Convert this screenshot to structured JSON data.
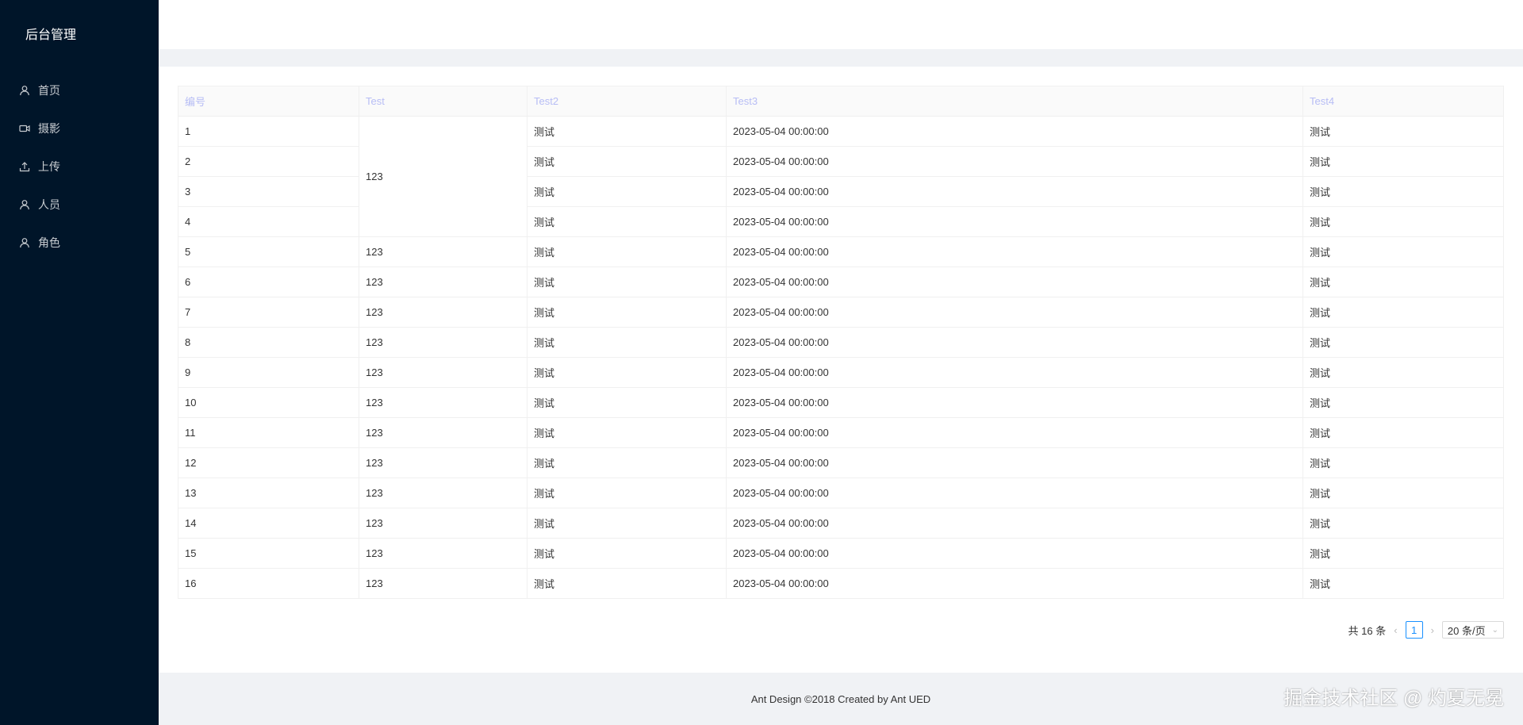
{
  "sidebar": {
    "title": "后台管理",
    "items": [
      {
        "label": "首页",
        "icon": "user-icon"
      },
      {
        "label": "摄影",
        "icon": "video-camera-icon"
      },
      {
        "label": "上传",
        "icon": "upload-icon"
      },
      {
        "label": "人员",
        "icon": "user-icon"
      },
      {
        "label": "角色",
        "icon": "user-icon"
      }
    ]
  },
  "table": {
    "columns": [
      "编号",
      "Test",
      "Test2",
      "Test3",
      "Test4"
    ],
    "merged_test_value": "123",
    "rows": [
      [
        "1",
        "123",
        "测试",
        "2023-05-04 00:00:00",
        "测试"
      ],
      [
        "2",
        "123",
        "测试",
        "2023-05-04 00:00:00",
        "测试"
      ],
      [
        "3",
        "123",
        "测试",
        "2023-05-04 00:00:00",
        "测试"
      ],
      [
        "4",
        "123",
        "测试",
        "2023-05-04 00:00:00",
        "测试"
      ],
      [
        "5",
        "123",
        "测试",
        "2023-05-04 00:00:00",
        "测试"
      ],
      [
        "6",
        "123",
        "测试",
        "2023-05-04 00:00:00",
        "测试"
      ],
      [
        "7",
        "123",
        "测试",
        "2023-05-04 00:00:00",
        "测试"
      ],
      [
        "8",
        "123",
        "测试",
        "2023-05-04 00:00:00",
        "测试"
      ],
      [
        "9",
        "123",
        "测试",
        "2023-05-04 00:00:00",
        "测试"
      ],
      [
        "10",
        "123",
        "测试",
        "2023-05-04 00:00:00",
        "测试"
      ],
      [
        "11",
        "123",
        "测试",
        "2023-05-04 00:00:00",
        "测试"
      ],
      [
        "12",
        "123",
        "测试",
        "2023-05-04 00:00:00",
        "测试"
      ],
      [
        "13",
        "123",
        "测试",
        "2023-05-04 00:00:00",
        "测试"
      ],
      [
        "14",
        "123",
        "测试",
        "2023-05-04 00:00:00",
        "测试"
      ],
      [
        "15",
        "123",
        "测试",
        "2023-05-04 00:00:00",
        "测试"
      ],
      [
        "16",
        "123",
        "测试",
        "2023-05-04 00:00:00",
        "测试"
      ]
    ]
  },
  "pagination": {
    "total_text": "共 16 条",
    "current_page": "1",
    "page_size": "20 条/页"
  },
  "footer": {
    "text": "Ant Design ©2018 Created by Ant UED"
  },
  "watermark": "掘金技术社区 @ 灼夏无冕",
  "colors": {
    "sidebar_bg": "#001529",
    "header_text": "#b7bdf5",
    "accent": "#1890ff"
  }
}
